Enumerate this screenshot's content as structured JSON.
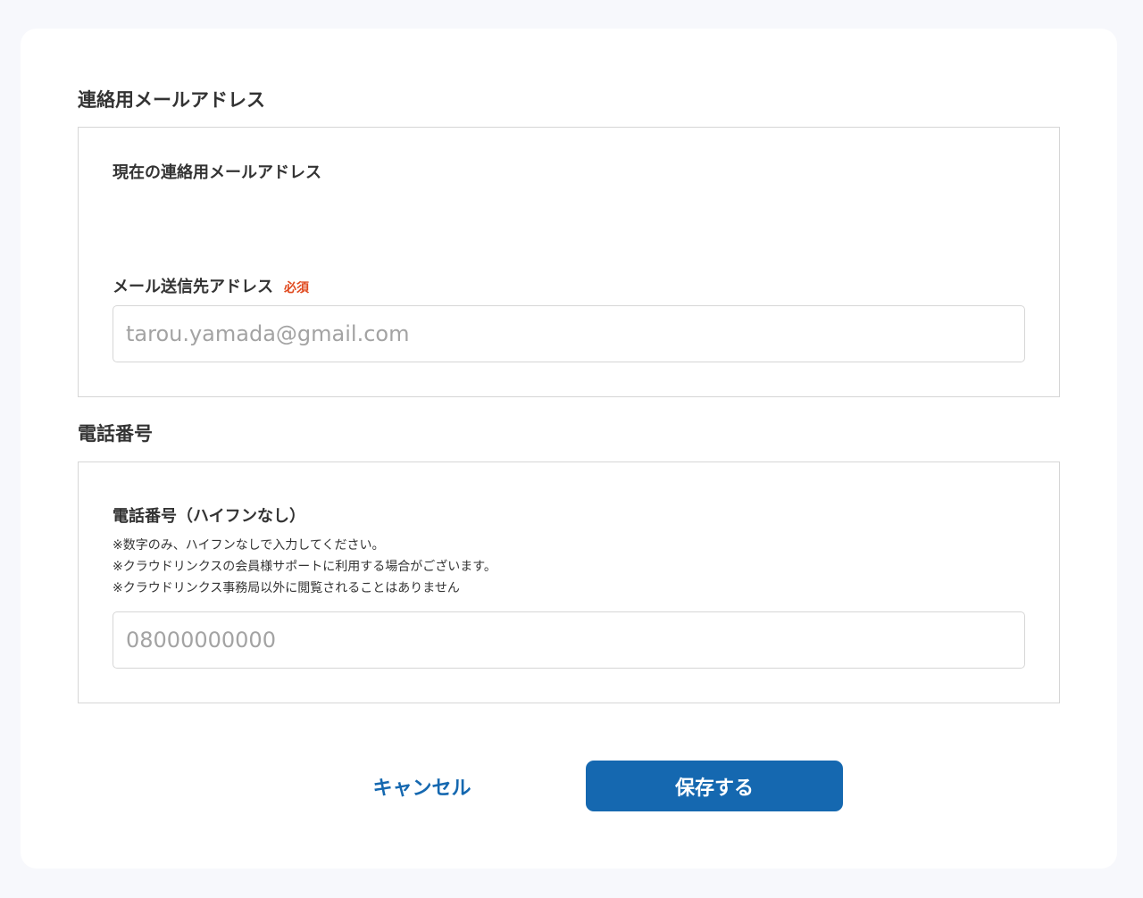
{
  "email_section": {
    "title": "連絡用メールアドレス",
    "current_label": "現在の連絡用メールアドレス",
    "current_value": "",
    "send_label": "メール送信先アドレス",
    "required_badge": "必須",
    "input_value": "",
    "input_placeholder": "tarou.yamada@gmail.com"
  },
  "phone_section": {
    "title": "電話番号",
    "label": "電話番号（ハイフンなし）",
    "notes": [
      "※数字のみ、ハイフンなしで入力してください。",
      "※クラウドリンクスの会員様サポートに利用する場合がございます。",
      "※クラウドリンクス事務局以外に閲覧されることはありません"
    ],
    "input_value": "",
    "input_placeholder": "08000000000"
  },
  "actions": {
    "cancel_label": "キャンセル",
    "save_label": "保存する"
  },
  "colors": {
    "accent": "#1568b0",
    "required": "#e04a1f",
    "background": "#f7f8fc",
    "border": "#d6d6d6"
  }
}
